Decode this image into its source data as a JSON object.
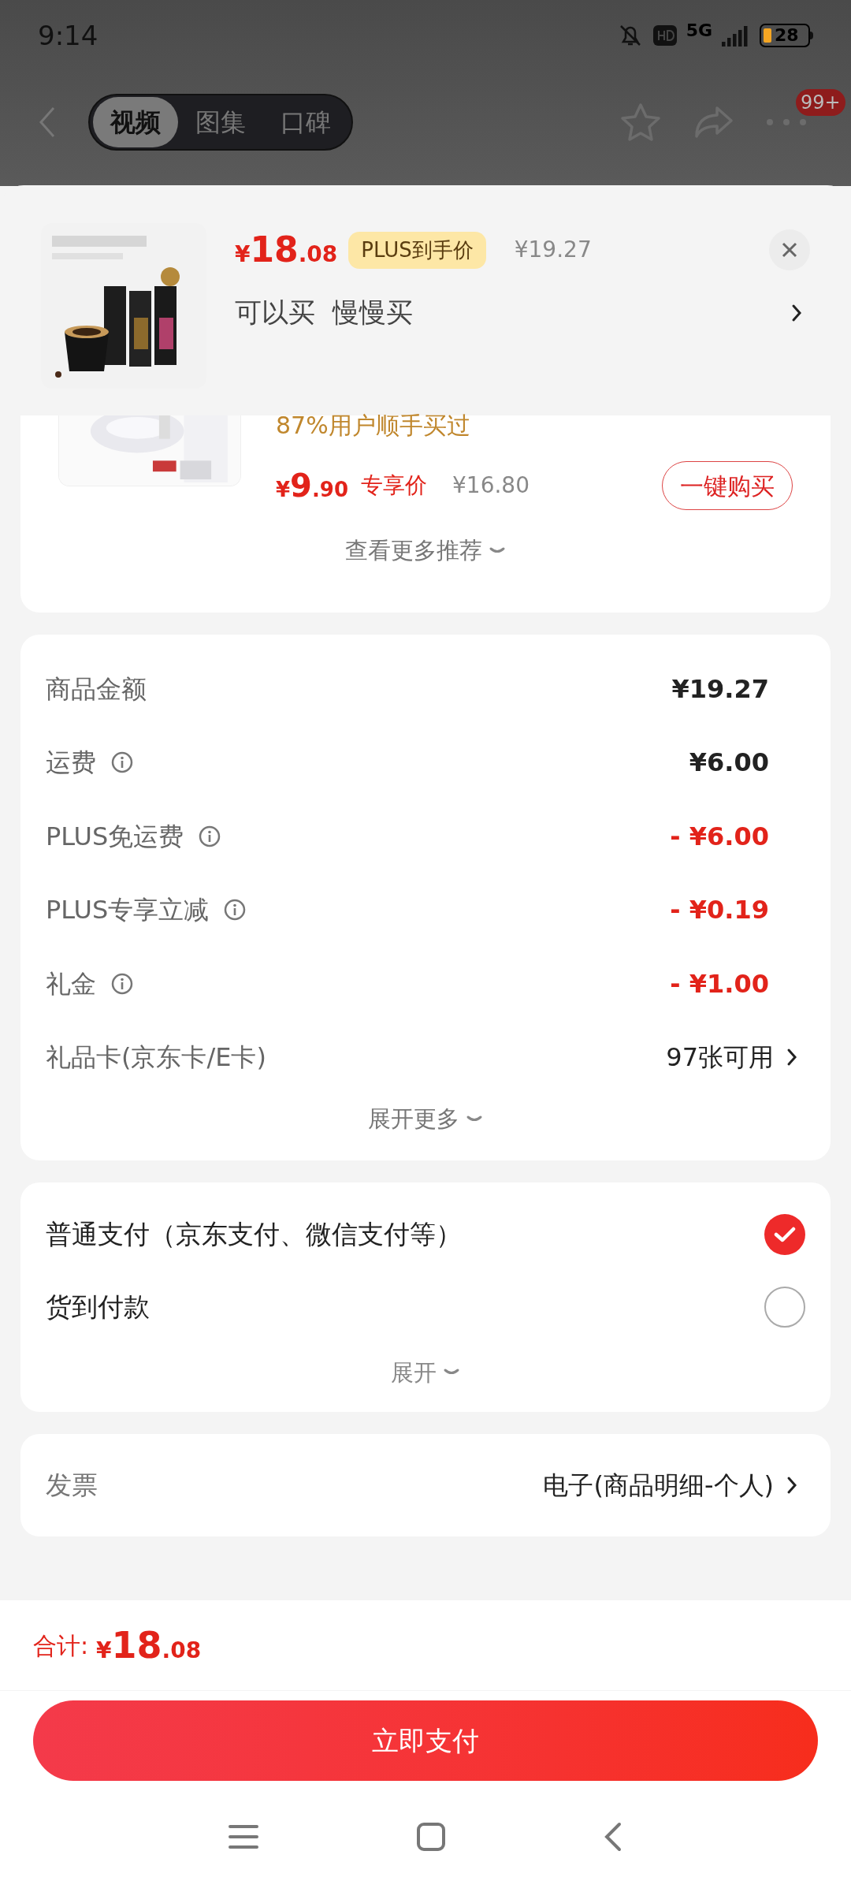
{
  "status_bar": {
    "time": "9:14",
    "network": "5G",
    "battery": "28"
  },
  "nav": {
    "tabs": [
      {
        "label": "视频",
        "selected": true
      },
      {
        "label": "图集",
        "selected": false
      },
      {
        "label": "口碑",
        "selected": false
      }
    ],
    "badge": "99+"
  },
  "product": {
    "price": {
      "symbol": "¥",
      "integer": "18",
      "decimal": ".08"
    },
    "price_tag": "PLUS到手价",
    "original_price": "¥19.27",
    "title": "可以买  慢慢买"
  },
  "recommendation": {
    "note": "87%用户顺手买过",
    "price": {
      "symbol": "¥",
      "integer": "9",
      "decimal": ".90"
    },
    "price_tag": "专享价",
    "original_price": "¥16.80",
    "button": "一键购买",
    "more": "查看更多推荐"
  },
  "fees": {
    "rows": [
      {
        "label": "商品金额",
        "info": false,
        "value": "¥19.27",
        "kind": "amount"
      },
      {
        "label": "运费",
        "info": true,
        "value": "¥6.00",
        "kind": "amount"
      },
      {
        "label": "PLUS免运费",
        "info": true,
        "value": "- ¥6.00",
        "kind": "discount"
      },
      {
        "label": "PLUS专享立减",
        "info": true,
        "value": "- ¥0.19",
        "kind": "discount"
      },
      {
        "label": "礼金",
        "info": true,
        "value": "- ¥1.00",
        "kind": "discount"
      },
      {
        "label": "礼品卡(京东卡/E卡)",
        "info": false,
        "value": "97张可用",
        "kind": "link"
      }
    ],
    "more": "展开更多"
  },
  "payment": {
    "options": [
      {
        "label": "普通支付（京东支付、微信支付等）",
        "selected": true
      },
      {
        "label": "货到付款",
        "selected": false
      }
    ],
    "more": "展开"
  },
  "invoice": {
    "label": "发票",
    "value": "电子(商品明细-个人)"
  },
  "footer": {
    "total_label": "合计:",
    "total": {
      "symbol": "¥",
      "integer": "18",
      "decimal": ".08"
    },
    "pay_button": "立即支付"
  }
}
